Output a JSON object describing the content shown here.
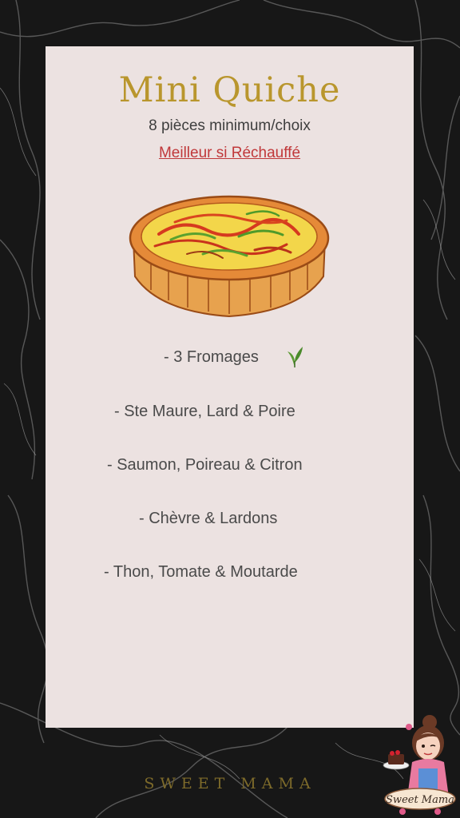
{
  "menu": {
    "title": "Mini Quiche",
    "subtitle": "8 pièces minimum/choix",
    "note": "Meilleur si Réchauffé",
    "flavors": [
      "- 3 Fromages",
      "- Ste Maure, Lard & Poire",
      "- Saumon, Poireau & Citron",
      "- Chèvre & Lardons",
      "- Thon, Tomate & Moutarde"
    ]
  },
  "brand": {
    "name": "SWEET MAMA",
    "logo_text": "Sweet Mama"
  },
  "icons": {
    "vegetarian": "leaf-icon",
    "illustration": "quiche-illustration"
  },
  "colors": {
    "background": "#161616",
    "card": "#ece2e1",
    "title": "#b9962d",
    "note": "#c0383a",
    "leaf": "#4a8a2a"
  }
}
